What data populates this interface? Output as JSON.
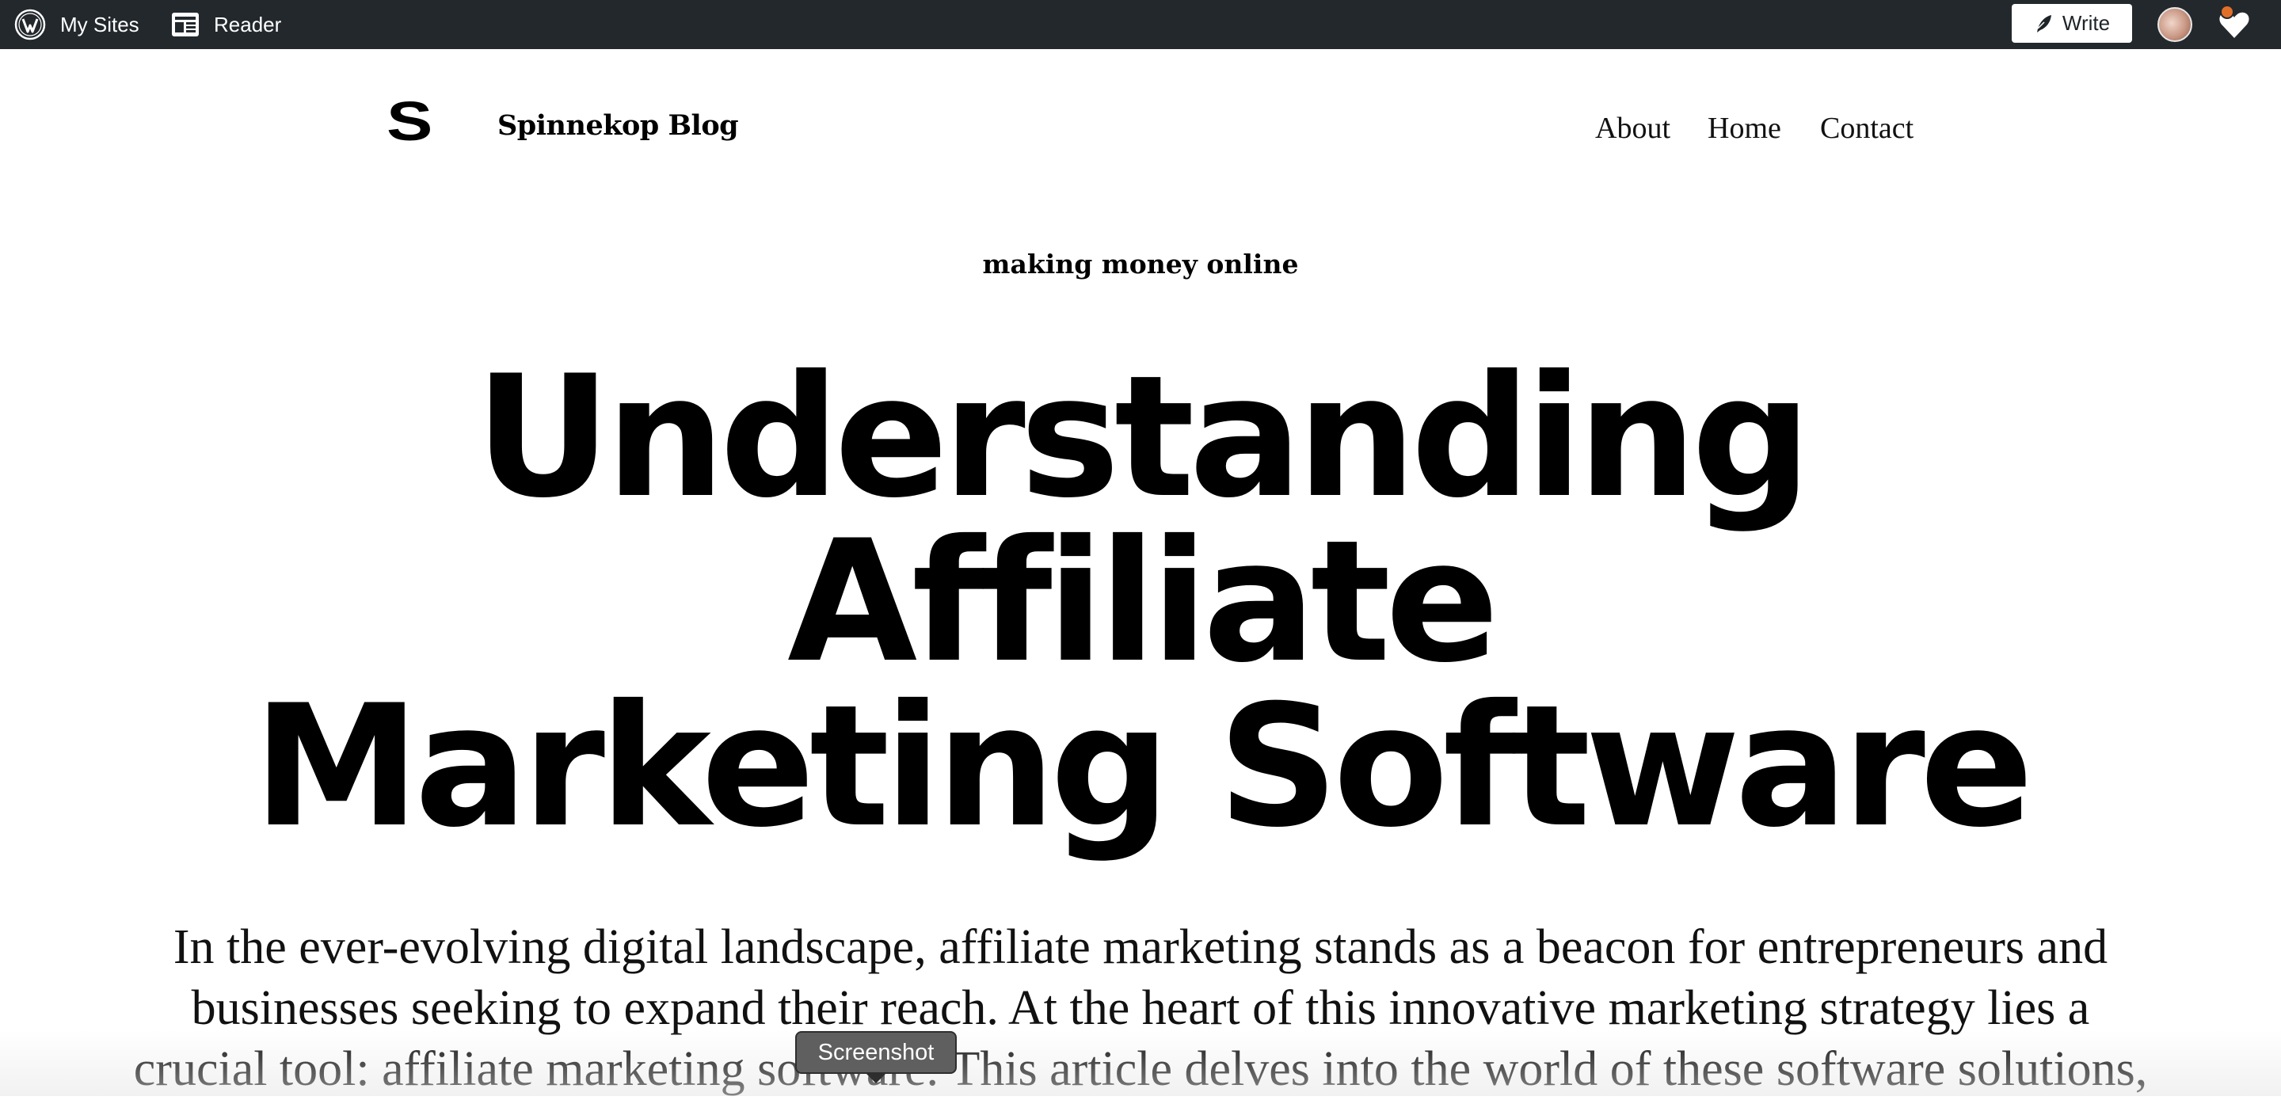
{
  "adminbar": {
    "mysites_label": "My Sites",
    "reader_label": "Reader",
    "write_label": "Write",
    "background": "#23282d"
  },
  "site": {
    "logo": "S",
    "title": "Spinnekop Blog",
    "nav": [
      "About",
      "Home",
      "Contact"
    ]
  },
  "post": {
    "category": "making money online",
    "title_lines": [
      "Understanding",
      "Affiliate",
      "Marketing Software"
    ],
    "body_lines": [
      "In the ever-evolving digital landscape, affiliate marketing stands as a beacon for entrepreneurs and",
      "businesses seeking to expand their reach. At the heart of this innovative marketing strategy lies a",
      "crucial tool: affiliate marketing software. This article delves into the world of these software solutions,"
    ]
  },
  "tooltip": {
    "label": "Screenshot"
  },
  "icons": {
    "wordpress": "wordpress-logo-icon",
    "reader": "reader-icon",
    "write": "pen-icon",
    "notifications": "notifications-heart-icon"
  }
}
